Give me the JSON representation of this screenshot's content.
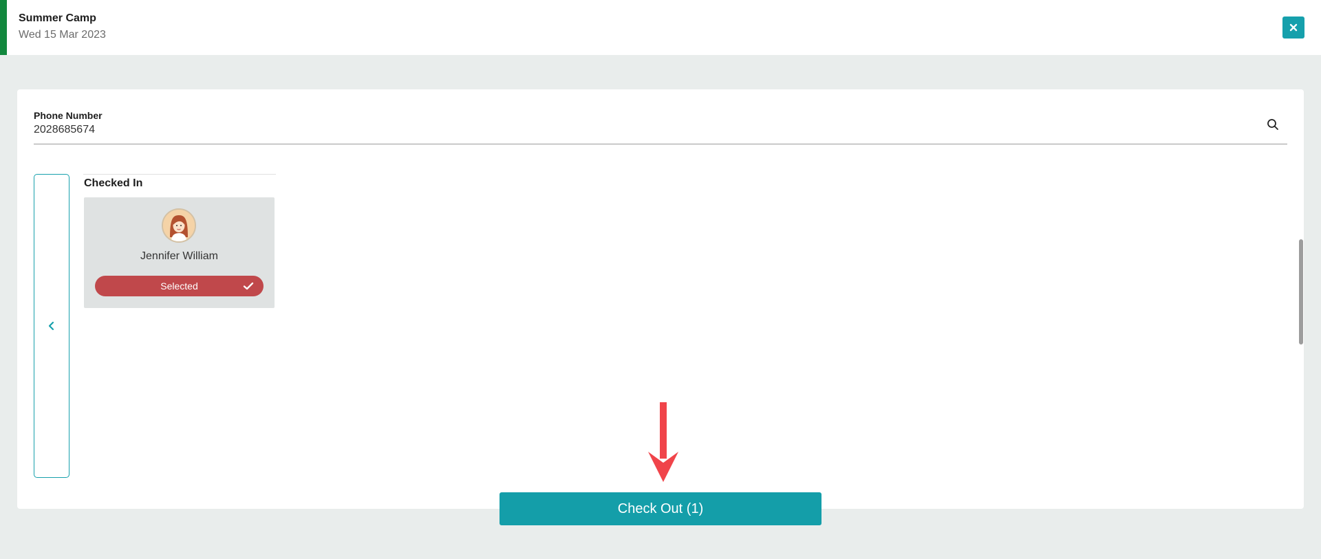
{
  "header": {
    "title": "Summer Camp",
    "date": "Wed 15 Mar 2023",
    "accent_color": "#12883e",
    "close_icon": "close-icon"
  },
  "search": {
    "label": "Phone Number",
    "value": "2028685674",
    "icon": "search-icon"
  },
  "section": {
    "title": "Checked In"
  },
  "people": [
    {
      "name": "Jennifer William",
      "status": "Selected",
      "status_color": "#c0484b"
    }
  ],
  "actions": {
    "checkout_label": "Check Out (1)",
    "checkout_color": "#149ea9"
  },
  "annotation": {
    "arrow_color": "#f0444a"
  }
}
